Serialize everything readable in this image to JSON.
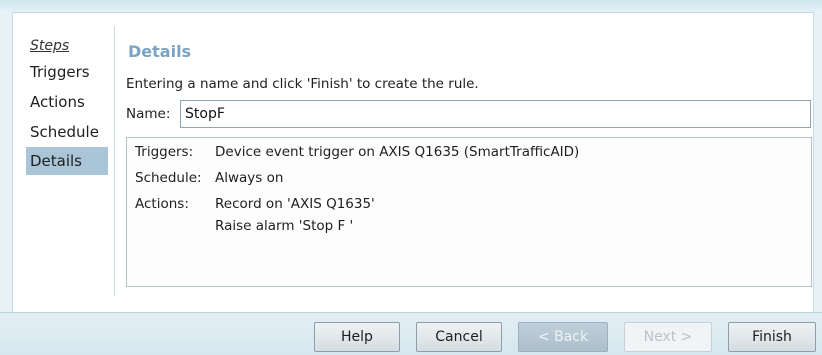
{
  "sidebar": {
    "header": "Steps",
    "items": [
      {
        "label": "Triggers"
      },
      {
        "label": "Actions"
      },
      {
        "label": "Schedule"
      },
      {
        "label": "Details"
      }
    ]
  },
  "details": {
    "title": "Details",
    "instruction": "Entering a name and click 'Finish' to create the rule.",
    "name_label": "Name:",
    "name_value": "StopF"
  },
  "summary": {
    "triggers_label": "Triggers:",
    "triggers_value": "Device event trigger on AXIS Q1635 (SmartTrafficAID)",
    "schedule_label": "Schedule:",
    "schedule_value": "Always on",
    "actions_label": "Actions:",
    "actions_value_1": "Record on 'AXIS Q1635'",
    "actions_value_2": "Raise alarm 'Stop F '"
  },
  "buttons": {
    "help": "Help",
    "cancel": "Cancel",
    "back": "< Back",
    "next": "Next >",
    "finish": "Finish"
  },
  "colors": {
    "selected_step_bg": "#aac4d8",
    "section_title": "#7aa3c4"
  }
}
